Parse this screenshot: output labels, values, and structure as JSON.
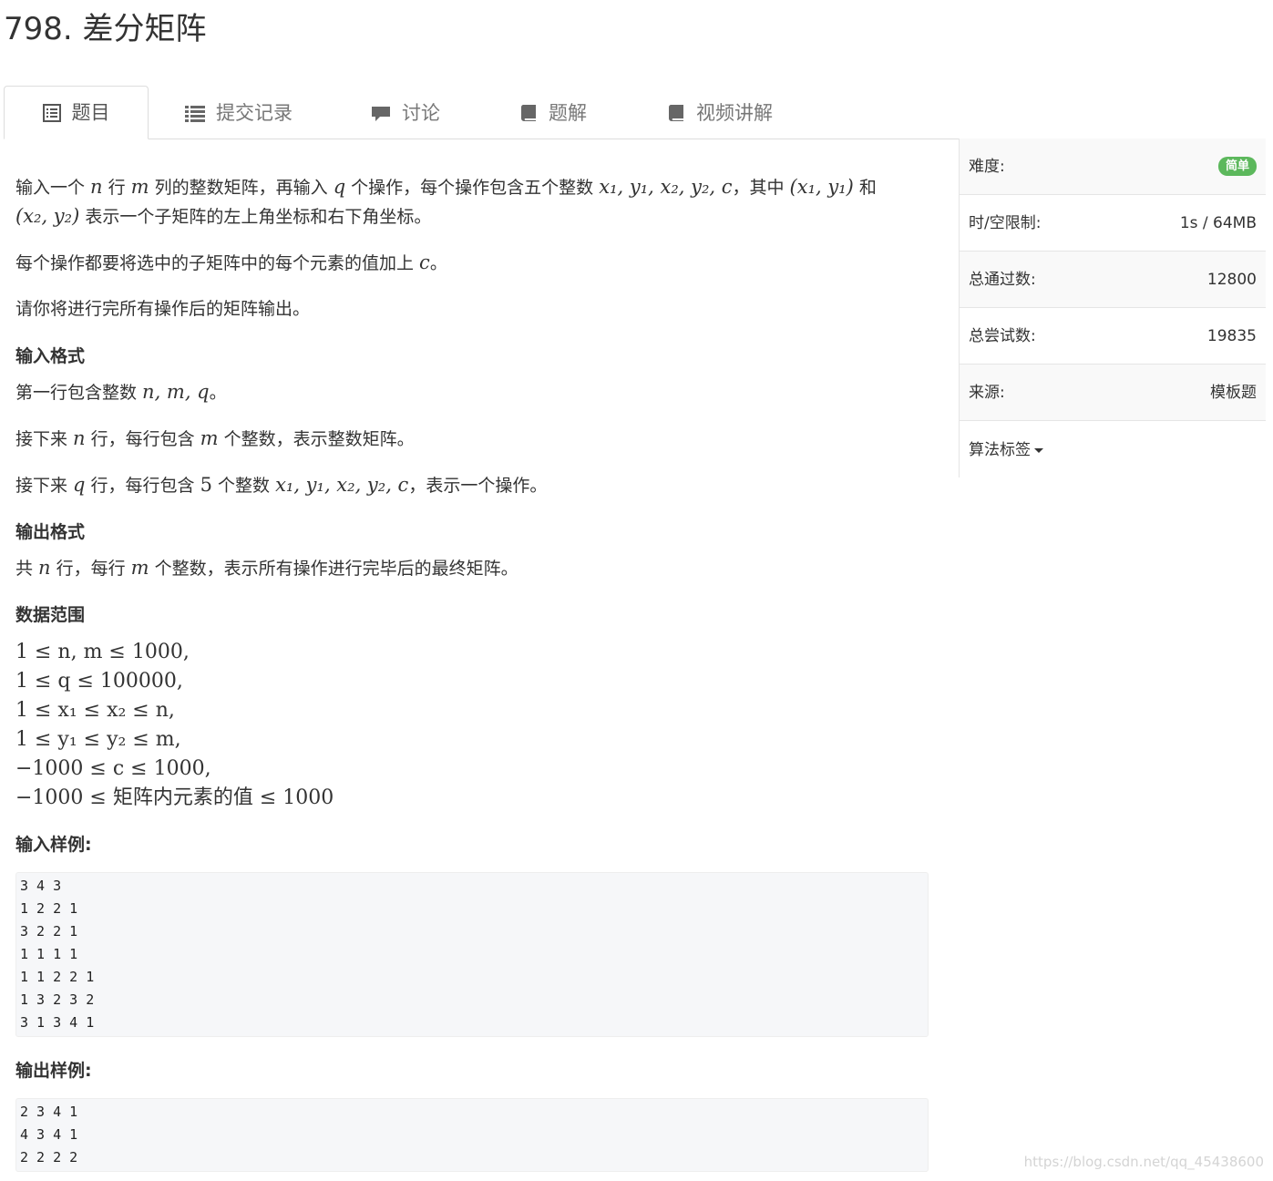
{
  "problem": {
    "title": "798. 差分矩阵"
  },
  "tabs": [
    {
      "label": "题目",
      "icon": "list-alt-icon",
      "active": true
    },
    {
      "label": "提交记录",
      "icon": "list-icon",
      "active": false
    },
    {
      "label": "讨论",
      "icon": "comment-icon",
      "active": false
    },
    {
      "label": "题解",
      "icon": "book-icon",
      "active": false
    },
    {
      "label": "视频讲解",
      "icon": "book-icon",
      "active": false
    }
  ],
  "description": {
    "line1_a": "输入一个 ",
    "line1_n": "n",
    "line1_b": " 行 ",
    "line1_m": "m",
    "line1_c": " 列的整数矩阵，再输入 ",
    "line1_q": "q",
    "line1_d": " 个操作，每个操作包含五个整数 ",
    "line1_vars": "x₁, y₁, x₂, y₂, c",
    "line1_e": "，其中 ",
    "line1_p1": "(x₁, y₁)",
    "line1_f": " 和",
    "line2_p2": "(x₂, y₂)",
    "line2_a": " 表示一个子矩阵的左上角坐标和右下角坐标。",
    "para2_a": "每个操作都要将选中的子矩阵中的每个元素的值加上 ",
    "para2_c": "c",
    "para2_b": "。",
    "para3": "请你将进行完所有操作后的矩阵输出。"
  },
  "input_format": {
    "heading": "输入格式",
    "l1_a": "第一行包含整数 ",
    "l1_vars": "n, m, q",
    "l1_b": "。",
    "l2_a": "接下来 ",
    "l2_n": "n",
    "l2_b": " 行，每行包含 ",
    "l2_m": "m",
    "l2_c": " 个整数，表示整数矩阵。",
    "l3_a": "接下来 ",
    "l3_q": "q",
    "l3_b": " 行，每行包含 ",
    "l3_5": "5",
    "l3_c": " 个整数 ",
    "l3_vars": "x₁, y₁, x₂, y₂, c",
    "l3_d": "，表示一个操作。"
  },
  "output_format": {
    "heading": "输出格式",
    "a": "共 ",
    "n": "n",
    "b": " 行，每行 ",
    "m": "m",
    "c": " 个整数，表示所有操作进行完毕后的最终矩阵。"
  },
  "constraints": {
    "heading": "数据范围",
    "lines": [
      "1 ≤ n, m ≤ 1000,",
      "1 ≤ q ≤ 100000,",
      "1 ≤ x₁ ≤ x₂ ≤ n,",
      "1 ≤ y₁ ≤ y₂ ≤ m,",
      "−1000 ≤ c ≤ 1000,",
      "−1000 ≤ 矩阵内元素的值 ≤ 1000"
    ]
  },
  "sample_input": {
    "heading": "输入样例:",
    "lines": [
      "3 4 3",
      "1 2 2 1",
      "3 2 2 1",
      "1 1 1 1",
      "1 1 2 2 1",
      "1 3 2 3 2",
      "3 1 3 4 1"
    ]
  },
  "sample_output": {
    "heading": "输出样例:",
    "lines": [
      "2 3 4 1",
      "4 3 4 1",
      "2 2 2 2"
    ]
  },
  "sidebar": {
    "difficulty_label": "难度:",
    "difficulty_value": "简单",
    "difficulty_color": "#5cb85c",
    "limit_label": "时/空限制:",
    "limit_value": "1s / 64MB",
    "passed_label": "总通过数:",
    "passed_value": "12800",
    "attempts_label": "总尝试数:",
    "attempts_value": "19835",
    "source_label": "来源:",
    "source_value": "模板题",
    "tags_label": "算法标签"
  },
  "watermark": "https://blog.csdn.net/qq_45438600"
}
